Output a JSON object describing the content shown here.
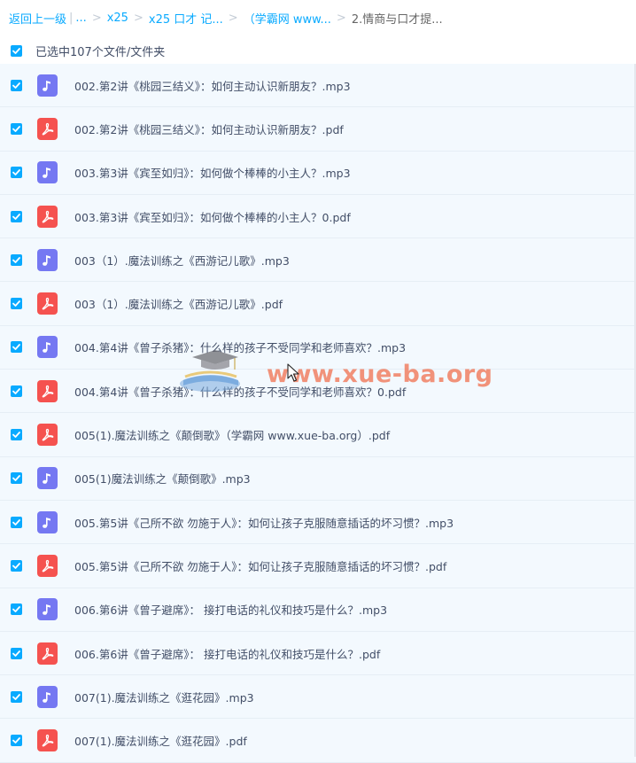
{
  "breadcrumb": {
    "back": "返回上一级",
    "ellipsis": "...",
    "items": [
      "x25",
      "x25 口才 记...",
      "（学霸网 www...",
      "2.情商与口才提..."
    ]
  },
  "selection": {
    "label": "已选中107个文件/文件夹",
    "checked": true
  },
  "files": [
    {
      "type": "mp3",
      "name": "002.第2讲《桃园三结义》：如何主动认识新朋友？.mp3"
    },
    {
      "type": "pdf",
      "name": "002.第2讲《桃园三结义》：如何主动认识新朋友？.pdf"
    },
    {
      "type": "mp3",
      "name": "003.第3讲《宾至如归》：如何做个棒棒的小主人？.mp3"
    },
    {
      "type": "pdf",
      "name": "003.第3讲《宾至如归》：如何做个棒棒的小主人？0.pdf"
    },
    {
      "type": "mp3",
      "name": "003（1）.魔法训练之《西游记儿歌》.mp3"
    },
    {
      "type": "pdf",
      "name": "003（1）.魔法训练之《西游记儿歌》.pdf"
    },
    {
      "type": "mp3",
      "name": "004.第4讲《曾子杀猪》：什么样的孩子不受同学和老师喜欢？.mp3"
    },
    {
      "type": "pdf",
      "name": "004.第4讲《曾子杀猪》：什么样的孩子不受同学和老师喜欢？0.pdf"
    },
    {
      "type": "pdf",
      "name": "005(1).魔法训练之《颠倒歌》（学霸网 www.xue-ba.org）.pdf"
    },
    {
      "type": "mp3",
      "name": "005(1)魔法训练之《颠倒歌》.mp3"
    },
    {
      "type": "mp3",
      "name": "005.第5讲《己所不欲 勿施于人》：如何让孩子克服随意插话的坏习惯？.mp3"
    },
    {
      "type": "pdf",
      "name": "005.第5讲《己所不欲 勿施于人》：如何让孩子克服随意插话的坏习惯？.pdf"
    },
    {
      "type": "mp3",
      "name": "006.第6讲《曾子避席》： 接打电话的礼仪和技巧是什么？.mp3"
    },
    {
      "type": "pdf",
      "name": "006.第6讲《曾子避席》： 接打电话的礼仪和技巧是什么？.pdf"
    },
    {
      "type": "mp3",
      "name": "007(1).魔法训练之《逛花园》.mp3"
    },
    {
      "type": "pdf",
      "name": "007(1).魔法训练之《逛花园》.pdf"
    }
  ],
  "watermark": {
    "text": "www.xue-ba.org"
  },
  "colors": {
    "accent": "#09aaff",
    "mp3_icon": "#7578f2",
    "pdf_icon": "#f5524f",
    "row_bg": "#f3f9fe"
  }
}
